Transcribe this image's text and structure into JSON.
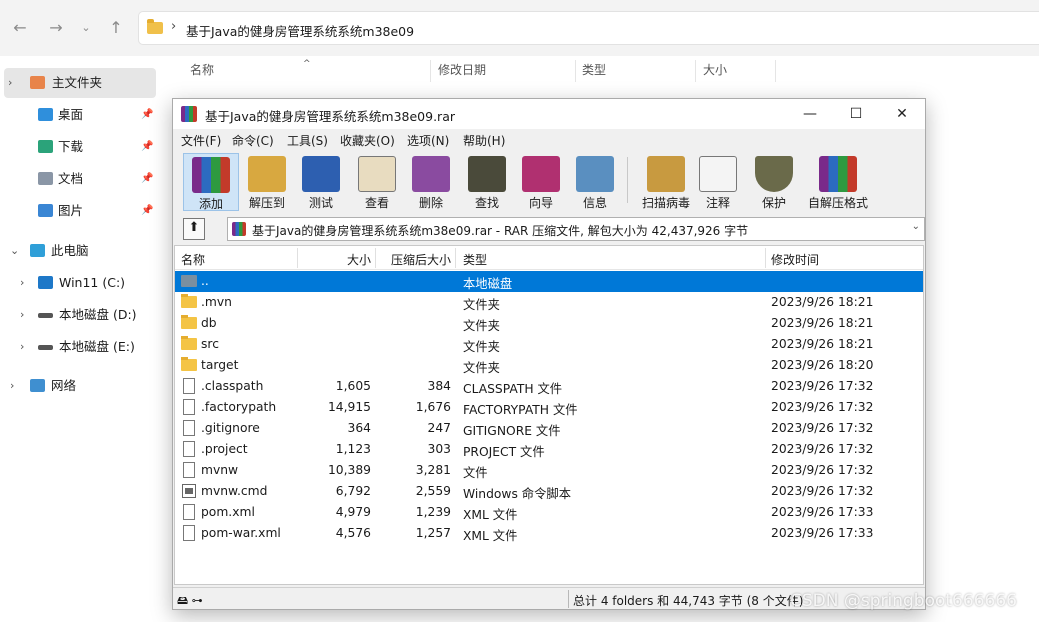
{
  "explorer": {
    "path": "基于Java的健身房管理系统系统m38e09",
    "columns": {
      "name": "名称",
      "modified": "修改日期",
      "type": "类型",
      "size": "大小"
    },
    "sidebar": [
      {
        "label": "主文件夹",
        "icon": "home-icon"
      },
      {
        "label": "桌面",
        "icon": "desktop-icon"
      },
      {
        "label": "下载",
        "icon": "download-icon"
      },
      {
        "label": "文档",
        "icon": "document-icon"
      },
      {
        "label": "图片",
        "icon": "picture-icon"
      },
      {
        "label": "此电脑",
        "icon": "pc-icon"
      },
      {
        "label": "Win11 (C:)",
        "icon": "windows-drive-icon"
      },
      {
        "label": "本地磁盘 (D:)",
        "icon": "drive-icon"
      },
      {
        "label": "本地磁盘 (E:)",
        "icon": "drive-icon"
      },
      {
        "label": "网络",
        "icon": "network-icon"
      }
    ]
  },
  "rar": {
    "title": "基于Java的健身房管理系统系统m38e09.rar",
    "menu": [
      "文件(F)",
      "命令(C)",
      "工具(S)",
      "收藏夹(O)",
      "选项(N)",
      "帮助(H)"
    ],
    "toolbar": [
      "添加",
      "解压到",
      "测试",
      "查看",
      "删除",
      "查找",
      "向导",
      "信息",
      "扫描病毒",
      "注释",
      "保护",
      "自解压格式"
    ],
    "pathbar": "基于Java的健身房管理系统系统m38e09.rar - RAR 压缩文件, 解包大小为 42,437,926 字节",
    "headers": {
      "name": "名称",
      "size": "大小",
      "packed": "压缩后大小",
      "type": "类型",
      "modified": "修改时间"
    },
    "files": [
      {
        "name": "..",
        "size": "",
        "packed": "",
        "type": "本地磁盘",
        "modified": ""
      },
      {
        "name": ".mvn",
        "size": "",
        "packed": "",
        "type": "文件夹",
        "modified": "2023/9/26 18:21"
      },
      {
        "name": "db",
        "size": "",
        "packed": "",
        "type": "文件夹",
        "modified": "2023/9/26 18:21"
      },
      {
        "name": "src",
        "size": "",
        "packed": "",
        "type": "文件夹",
        "modified": "2023/9/26 18:21"
      },
      {
        "name": "target",
        "size": "",
        "packed": "",
        "type": "文件夹",
        "modified": "2023/9/26 18:20"
      },
      {
        "name": ".classpath",
        "size": "1,605",
        "packed": "384",
        "type": "CLASSPATH 文件",
        "modified": "2023/9/26 17:32"
      },
      {
        "name": ".factorypath",
        "size": "14,915",
        "packed": "1,676",
        "type": "FACTORYPATH 文件",
        "modified": "2023/9/26 17:32"
      },
      {
        "name": ".gitignore",
        "size": "364",
        "packed": "247",
        "type": "GITIGNORE 文件",
        "modified": "2023/9/26 17:32"
      },
      {
        "name": ".project",
        "size": "1,123",
        "packed": "303",
        "type": "PROJECT 文件",
        "modified": "2023/9/26 17:32"
      },
      {
        "name": "mvnw",
        "size": "10,389",
        "packed": "3,281",
        "type": "文件",
        "modified": "2023/9/26 17:32"
      },
      {
        "name": "mvnw.cmd",
        "size": "6,792",
        "packed": "2,559",
        "type": "Windows 命令脚本",
        "modified": "2023/9/26 17:32"
      },
      {
        "name": "pom.xml",
        "size": "4,979",
        "packed": "1,239",
        "type": "XML 文件",
        "modified": "2023/9/26 17:33"
      },
      {
        "name": "pom-war.xml",
        "size": "4,576",
        "packed": "1,257",
        "type": "XML 文件",
        "modified": "2023/9/26 17:33"
      }
    ],
    "status": "总计 4 folders 和 44,743 字节 (8 个文件)",
    "watermark": "CSDN @springboot666666"
  }
}
